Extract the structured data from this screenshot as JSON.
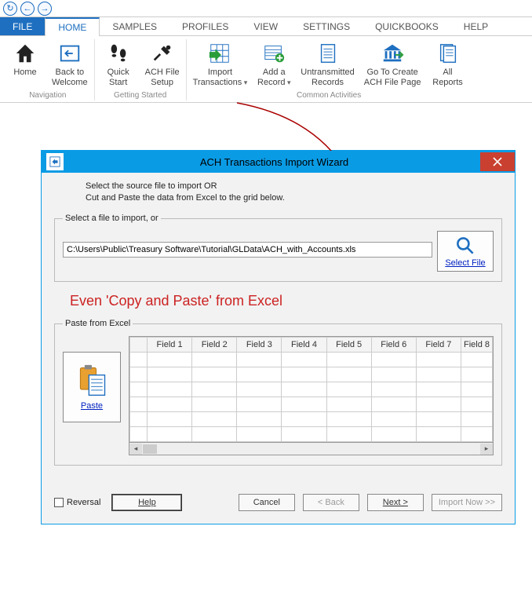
{
  "nav": {
    "back": "⟲",
    "left": "←",
    "right": "→"
  },
  "menu": {
    "file": "FILE",
    "home": "HOME",
    "samples": "SAMPLES",
    "profiles": "PROFILES",
    "view": "VIEW",
    "settings": "SETTINGS",
    "quickbooks": "QUICKBOOKS",
    "help": "HELP"
  },
  "ribbon": {
    "groups": {
      "navigation": "Navigation",
      "getting_started": "Getting Started",
      "common": "Common Activities"
    },
    "home": "Home",
    "back_welcome_1": "Back to",
    "back_welcome_2": "Welcome",
    "quick_start_1": "Quick",
    "quick_start_2": "Start",
    "ach_setup_1": "ACH File",
    "ach_setup_2": "Setup",
    "import_1": "Import",
    "import_2": "Transactions",
    "addrec_1": "Add a",
    "addrec_2": "Record",
    "untrans_1": "Untransmitted",
    "untrans_2": "Records",
    "goto_1": "Go To Create",
    "goto_2": "ACH File Page",
    "reports_1": "All",
    "reports_2": "Reports"
  },
  "wizard": {
    "title": "ACH Transactions Import Wizard",
    "intro_1": "Select the source file to import OR",
    "intro_2": "Cut and Paste the data from Excel to the grid below.",
    "select_legend": "Select a file to import, or",
    "path": "C:\\Users\\Public\\Treasury Software\\Tutorial\\GLData\\ACH_with_Accounts.xls",
    "select_file": "Select File",
    "callout": "Even 'Copy and Paste' from Excel",
    "paste_legend": "Paste from Excel",
    "paste": "Paste",
    "fields": [
      "Field 1",
      "Field 2",
      "Field 3",
      "Field 4",
      "Field 5",
      "Field 6",
      "Field 7",
      "Field 8"
    ],
    "reversal": "Reversal",
    "help": "Help",
    "cancel": "Cancel",
    "back": "< Back",
    "next": "Next >",
    "import_now": "Import Now >>"
  }
}
